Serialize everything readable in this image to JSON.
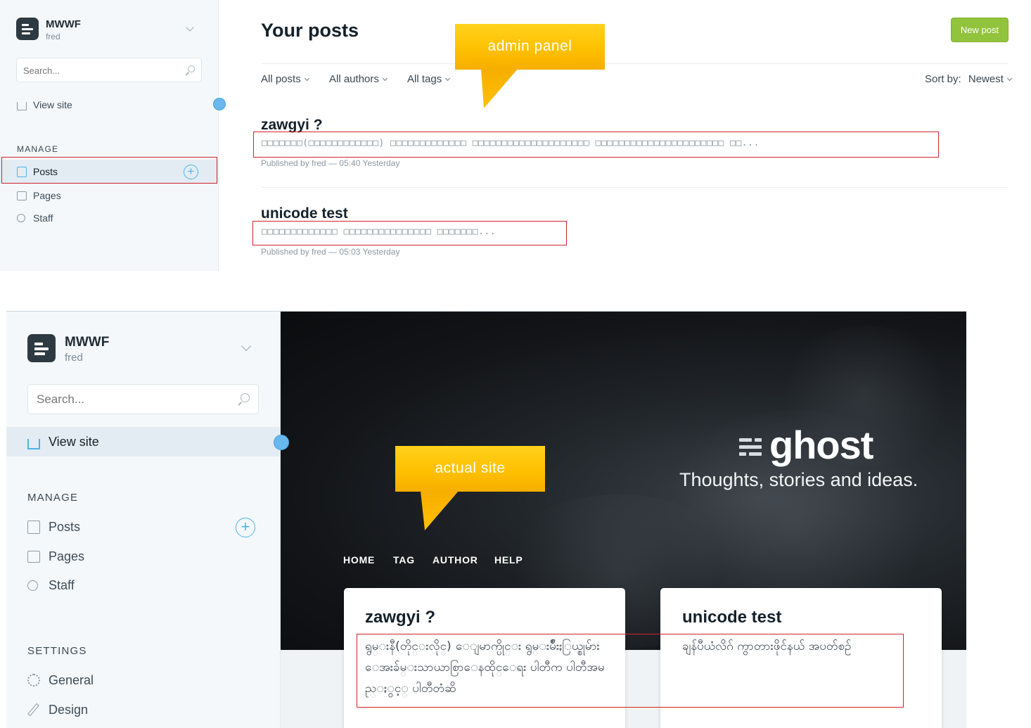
{
  "admin": {
    "blog_title": "MWWF",
    "blog_user": "fred",
    "search_placeholder": "Search...",
    "view_site": "View site",
    "manage_label": "MANAGE",
    "nav": {
      "posts": "Posts",
      "pages": "Pages",
      "staff": "Staff"
    },
    "page_title": "Your posts",
    "new_post": "New post",
    "filters": {
      "posts": "All posts",
      "authors": "All authors",
      "tags": "All tags"
    },
    "sort_label": "Sort by:",
    "sort_value": "Newest",
    "posts": [
      {
        "title": "zawgyi ?",
        "excerpt": "□□□□□□□(□□□□□□□□□□□□) □□□□□□□□□□□□□ □□□□□□□□□□□□□□□□□□□□ □□□□□□□□□□□□□□□□□□□□□□ □□...",
        "meta": "Published by fred — 05:40 Yesterday"
      },
      {
        "title": "unicode test",
        "excerpt": "□□□□□□□□□□□□□ □□□□□□□□□□□□□□□ □□□□□□□...",
        "meta": "Published by fred — 05:03 Yesterday"
      }
    ]
  },
  "callouts": {
    "admin": "admin panel",
    "site": "actual site"
  },
  "site_admin": {
    "blog_title": "MWWF",
    "blog_user": "fred",
    "search_placeholder": "Search...",
    "view_site": "View site",
    "manage_label": "MANAGE",
    "nav": {
      "posts": "Posts",
      "pages": "Pages",
      "staff": "Staff"
    },
    "settings_label": "SETTINGS",
    "settings": {
      "general": "General",
      "design": "Design"
    }
  },
  "site": {
    "logo_text": "ghost",
    "tagline": "Thoughts, stories and ideas.",
    "nav": [
      "HOME",
      "TAG",
      "AUTHOR",
      "HELP"
    ],
    "cards": [
      {
        "title": "zawgyi ?",
        "excerpt": "ရွမ္းနီ(တိုင္းလိုင္) ေျမာက္ပိုင္း ရွမ္းမ်ိဳးႏြယ္စုမ်ား ေအးခ်မ္းသာယာစြာေနထိုင္ေရး ပါတီက ပါတီအမည္ႏွင့္ ပါတီတံဆိ"
      },
      {
        "title": "unicode test",
        "excerpt": "ချန်ပီယံလိဂ် ကွာတားဖိုင်နယ် အပတ်စဉ်"
      }
    ]
  },
  "colors": {
    "accent_blue": "#4fb3e8",
    "new_post_green": "#92c33c",
    "annotation_red": "#d2232a",
    "callout_yellow": "#ffc000"
  }
}
